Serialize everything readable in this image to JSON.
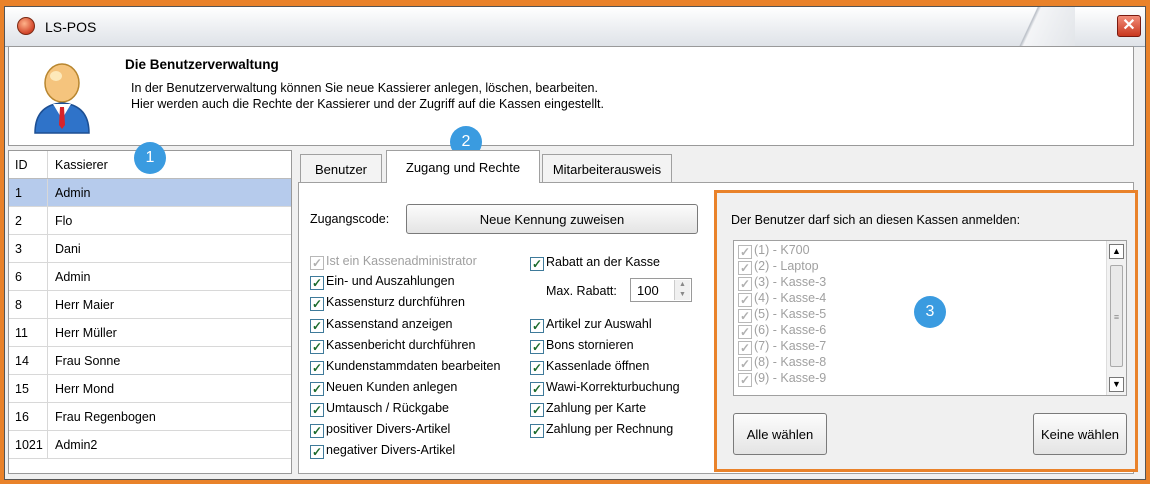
{
  "window": {
    "title": "LS-POS",
    "close_label": "✕"
  },
  "header": {
    "title": "Die Benutzerverwaltung",
    "line1": "In der Benutzerverwaltung können Sie neue Kassierer anlegen, löschen, bearbeiten.",
    "line2": "Hier werden auch die Rechte der Kassierer und der Zugriff auf die Kassen eingestellt."
  },
  "userlist": {
    "col_id": "ID",
    "col_name": "Kassierer",
    "rows": [
      {
        "id": "1",
        "name": "Admin",
        "selected": true
      },
      {
        "id": "2",
        "name": "Flo"
      },
      {
        "id": "3",
        "name": "Dani"
      },
      {
        "id": "6",
        "name": "Admin"
      },
      {
        "id": "8",
        "name": "Herr Maier"
      },
      {
        "id": "11",
        "name": "Herr Müller"
      },
      {
        "id": "14",
        "name": "Frau Sonne"
      },
      {
        "id": "15",
        "name": "Herr Mond"
      },
      {
        "id": "16",
        "name": "Frau Regenbogen"
      },
      {
        "id": "1021",
        "name": "Admin2"
      }
    ]
  },
  "badges": [
    "1",
    "2",
    "3"
  ],
  "tabs": [
    {
      "label": "Benutzer",
      "active": false
    },
    {
      "label": "Zugang und Rechte",
      "active": true
    },
    {
      "label": "Mitarbeiterausweis",
      "active": false
    }
  ],
  "access": {
    "code_label": "Zugangscode:",
    "new_code_button": "Neue Kennung zuweisen",
    "max_rabatt_label": "Max. Rabatt:",
    "max_rabatt_value": "100"
  },
  "rights_left": [
    {
      "label": "Ist ein Kassenadministrator",
      "checked": true,
      "disabled": true
    },
    {
      "label": "Ein- und Auszahlungen",
      "checked": true
    },
    {
      "label": "Kassensturz durchführen",
      "checked": true
    },
    {
      "label": "Kassenstand anzeigen",
      "checked": true
    },
    {
      "label": "Kassenbericht durchführen",
      "checked": true
    },
    {
      "label": "Kundenstammdaten bearbeiten",
      "checked": true
    },
    {
      "label": "Neuen Kunden anlegen",
      "checked": true
    },
    {
      "label": "Umtausch / Rückgabe",
      "checked": true
    },
    {
      "label": "positiver Divers-Artikel",
      "checked": true
    },
    {
      "label": "negativer Divers-Artikel",
      "checked": true
    }
  ],
  "rights_right": [
    {
      "label": "Rabatt an der Kasse",
      "checked": true
    },
    {
      "label": "Artikel zur Auswahl",
      "checked": true
    },
    {
      "label": "Bons stornieren",
      "checked": true
    },
    {
      "label": "Kassenlade öffnen",
      "checked": true
    },
    {
      "label": "Wawi-Korrekturbuchung",
      "checked": true
    },
    {
      "label": "Zahlung per Karte",
      "checked": true
    },
    {
      "label": "Zahlung per Rechnung",
      "checked": true
    }
  ],
  "kassen": {
    "label": "Der Benutzer darf sich an diesen Kassen anmelden:",
    "items": [
      "(1) - K700",
      "(2) - Laptop",
      "(3) - Kasse-3",
      "(4) - Kasse-4",
      "(5) - Kasse-5",
      "(6) - Kasse-6",
      "(7) - Kasse-7",
      "(8) - Kasse-8",
      "(9) - Kasse-9"
    ],
    "select_all_button": "Alle wählen",
    "select_none_button": "Keine wählen"
  },
  "colors": {
    "accent": "#e9822a",
    "badge": "#3a9be0",
    "selection": "#b6cbec"
  }
}
